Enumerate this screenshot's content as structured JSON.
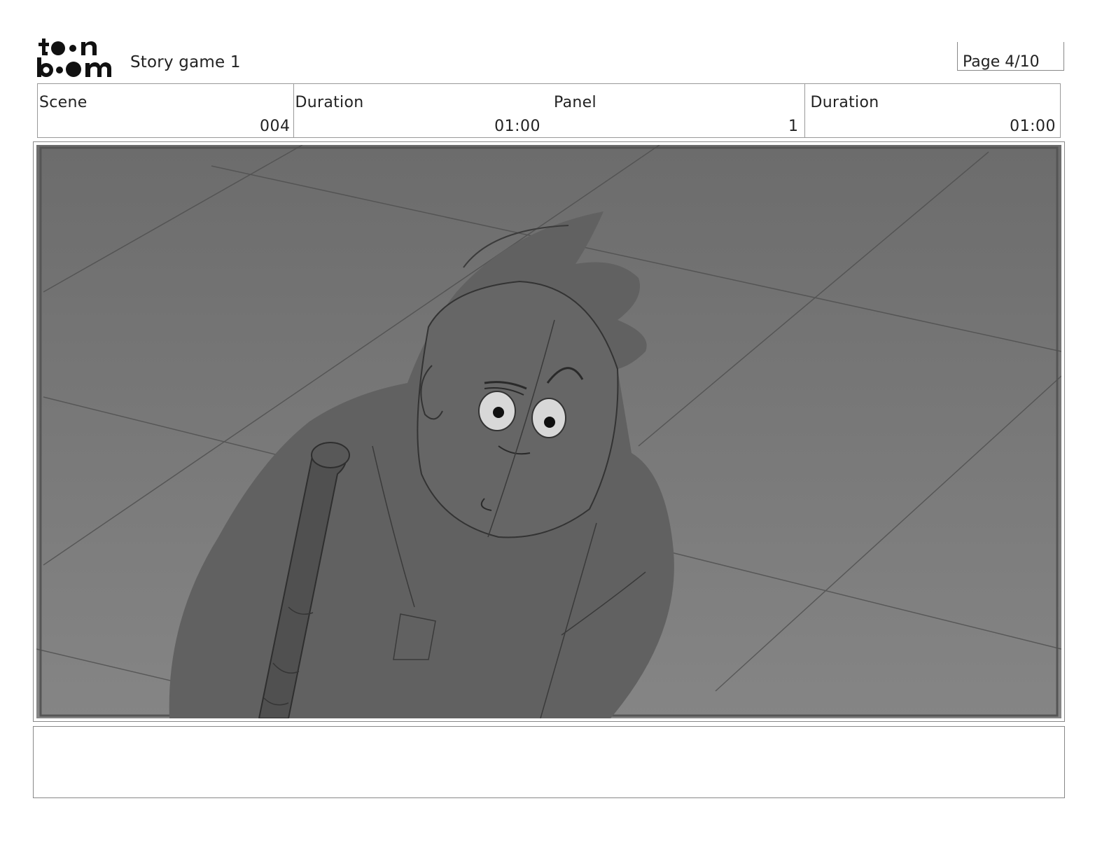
{
  "header": {
    "project_title": "Story game 1",
    "page_label": "Page 4/10"
  },
  "logo": {
    "name": "toonboom-logo",
    "text": "toon boom"
  },
  "info": {
    "scene": {
      "label": "Scene",
      "value": "004"
    },
    "scene_duration": {
      "label": "Duration",
      "value": "01:00"
    },
    "panel": {
      "label": "Panel",
      "value": "1"
    },
    "panel_duration": {
      "label": "Duration",
      "value": "01:00"
    }
  },
  "panel_image": {
    "icon": "storyboard-sketch",
    "colors": {
      "background": "#7a7a7a",
      "figure": "#606060",
      "staff": "#4f4f4f",
      "line": "#333333",
      "eye": "#d6d6d6"
    }
  },
  "notes": {
    "text": ""
  }
}
